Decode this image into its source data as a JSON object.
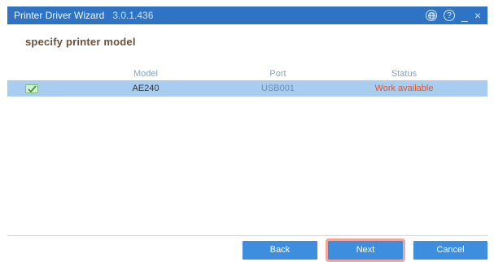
{
  "window": {
    "title": "Printer Driver Wizard",
    "version": "3.0.1.436",
    "globe_icon": "globe-icon",
    "help_icon": "help-icon",
    "minimize_label": "_",
    "close_label": "×"
  },
  "heading": "specify printer model",
  "table": {
    "columns": [
      "Model",
      "Port",
      "Status"
    ],
    "rows": [
      {
        "checked": true,
        "model": "AE240",
        "port": "USB001",
        "status": "Work available"
      }
    ]
  },
  "buttons": {
    "back": "Back",
    "next": "Next",
    "cancel": "Cancel"
  },
  "colors": {
    "titlebar": "#2f73c4",
    "selected_row": "#a9cdf0",
    "button": "#3d8ede",
    "status_text": "#e0552a",
    "focus_outline": "#f2a59a"
  }
}
